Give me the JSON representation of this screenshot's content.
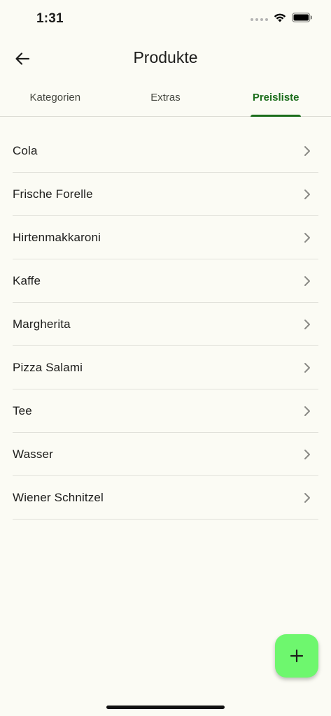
{
  "status_bar": {
    "time": "1:31"
  },
  "app_bar": {
    "title": "Produkte"
  },
  "tabs": [
    {
      "label": "Kategorien",
      "active": false
    },
    {
      "label": "Extras",
      "active": false
    },
    {
      "label": "Preisliste",
      "active": true
    }
  ],
  "products": [
    "Cola",
    "Frische Forelle",
    "Hirtenmakkaroni",
    "Kaffe",
    "Margherita",
    "Pizza Salami",
    "Tee",
    "Wasser",
    "Wiener Schnitzel"
  ],
  "icons": {
    "back": "arrow-left-icon",
    "chevron": "chevron-right-icon",
    "fab": "plus-icon"
  },
  "colors": {
    "background": "#fbfbf4",
    "accent": "#1b6d1b",
    "fab": "#6ef76e"
  }
}
